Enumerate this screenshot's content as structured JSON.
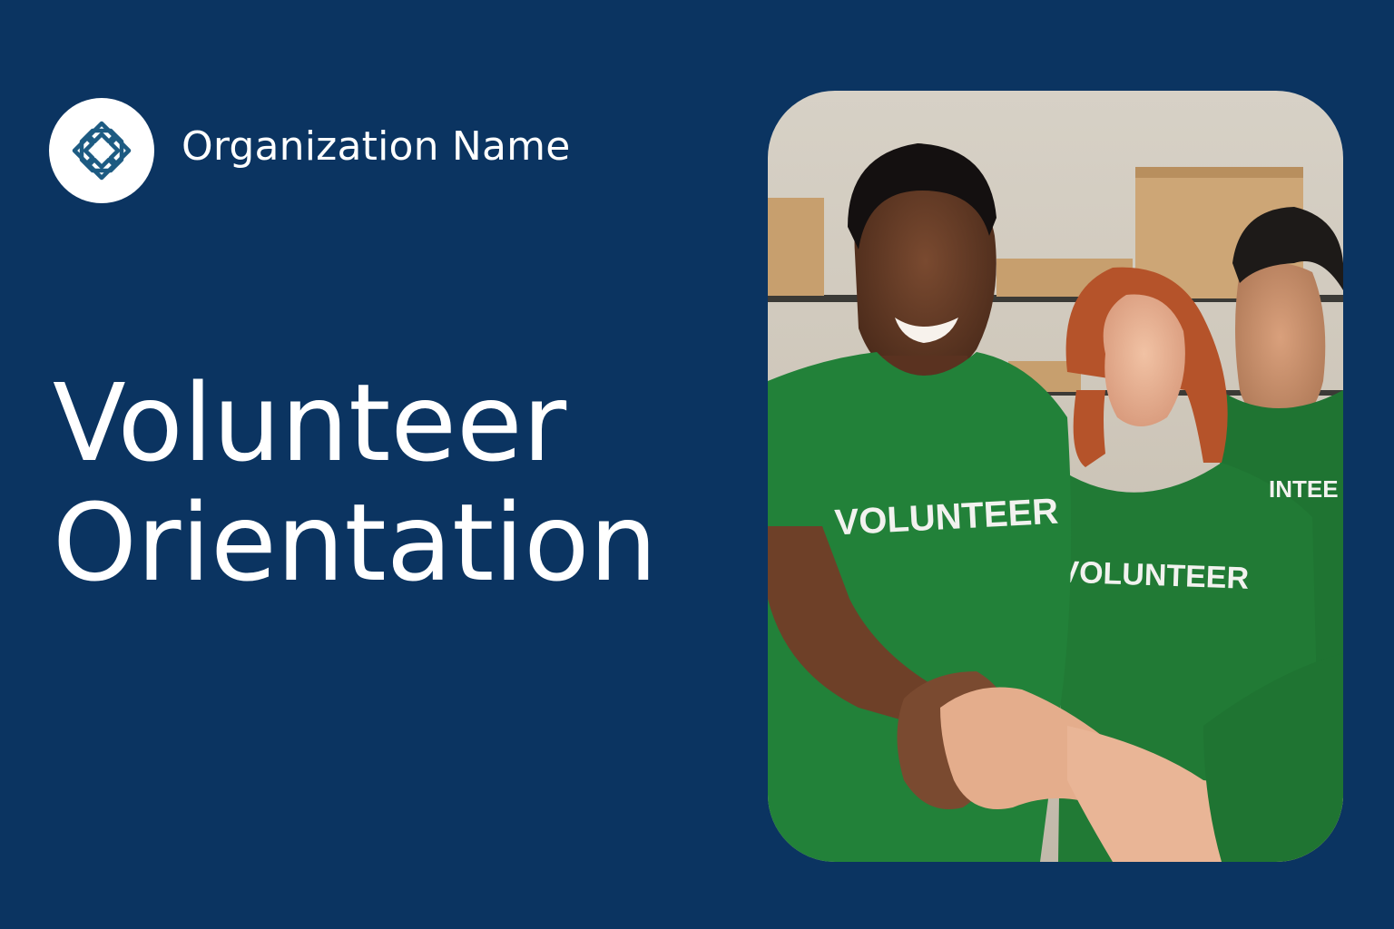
{
  "organization": {
    "name": "Organization Name",
    "logo_icon": "knot-star-icon"
  },
  "title": {
    "line1": "Volunteer",
    "line2": "Orientation"
  },
  "photo": {
    "description_icon": "volunteers-handshake-photo",
    "shirt_text": "VOLUNTEER",
    "shirt_text_partial": "INTEE"
  },
  "colors": {
    "background": "#0b3461",
    "logo_mark": "#1d5b82",
    "shirt_green": "#207a35"
  }
}
